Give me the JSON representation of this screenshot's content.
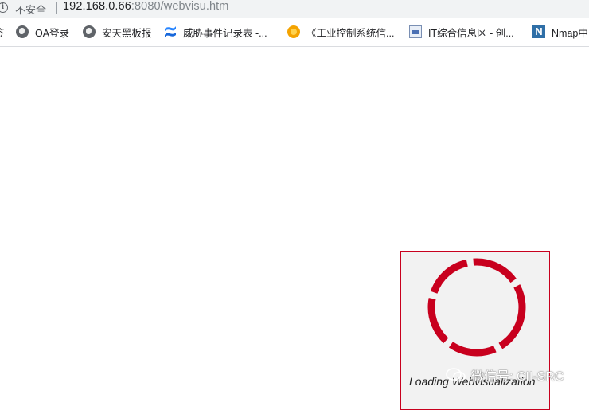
{
  "browser": {
    "security_label": "不安全",
    "url_host": "192.168.0.66",
    "url_rest": ":8080/webvisu.htm"
  },
  "bookmarks": {
    "partial_first": "签",
    "items": [
      {
        "label": "OA登录",
        "icon": "globe-icon"
      },
      {
        "label": "安天黑板报",
        "icon": "globe-icon"
      },
      {
        "label": "威胁事件记录表 -...",
        "icon": "confluence-icon"
      },
      {
        "label": "《工业控制系统信...",
        "icon": "sun-logo-icon"
      },
      {
        "label": "IT综合信息区 - 创...",
        "icon": "document-icon"
      },
      {
        "label": "Nmap中",
        "icon": "n-logo-icon"
      }
    ]
  },
  "loader": {
    "text": "Loading Webvisualization",
    "accent_color": "#c8001e"
  },
  "watermark": {
    "text": "微信号: CII-SRC"
  }
}
